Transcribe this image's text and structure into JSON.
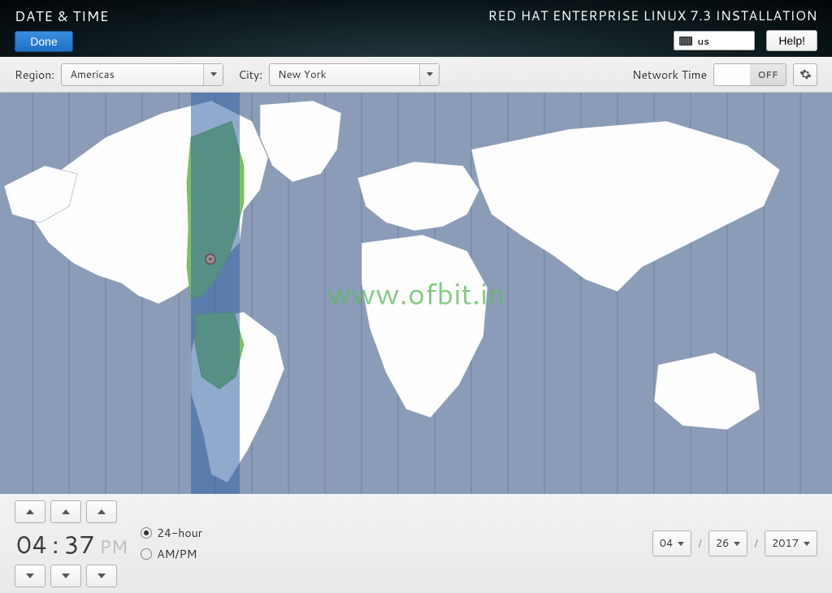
{
  "header": {
    "title": "DATE & TIME",
    "done_label": "Done",
    "installer_title": "RED HAT ENTERPRISE LINUX 7.3 INSTALLATION",
    "keyboard_layout": "us",
    "help_label": "Help!"
  },
  "toolbar": {
    "region_label": "Region:",
    "region_value": "Americas",
    "city_label": "City:",
    "city_value": "New York",
    "network_time_label": "Network Time",
    "network_time_state": "OFF"
  },
  "map": {
    "watermark": "www.ofbit.in",
    "selected_city": "New York"
  },
  "footer": {
    "time_hours": "04",
    "time_minutes": "37",
    "time_separator": ":",
    "ampm": "PM",
    "format_24h_label": "24-hour",
    "format_ampm_label": "AM/PM",
    "selected_format": "24-hour",
    "date_month": "04",
    "date_day": "26",
    "date_year": "2017"
  }
}
